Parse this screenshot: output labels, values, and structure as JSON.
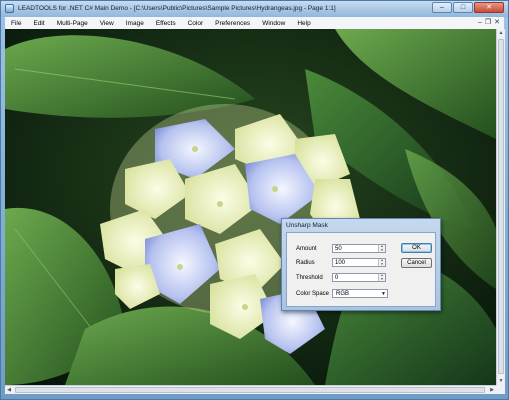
{
  "window": {
    "title": "LEADTOOLS for .NET C# Main Demo - [C:\\Users\\Public\\Pictures\\Sample Pictures\\Hydrangeas.jpg - Page 1:1]",
    "minimize": "–",
    "maximize": "□",
    "close": "✕"
  },
  "menubar": {
    "items": [
      "File",
      "Edit",
      "Multi-Page",
      "View",
      "Image",
      "Effects",
      "Color",
      "Preferences",
      "Window",
      "Help"
    ],
    "doc_min": "–",
    "doc_restore": "❐",
    "doc_close": "✕"
  },
  "image": {
    "subject": "hydrangea-photo"
  },
  "dialog": {
    "title": "Unsharp Mask",
    "amount_label": "Amount",
    "amount_value": "50",
    "radius_label": "Radius",
    "radius_value": "100",
    "threshold_label": "Threshold",
    "threshold_value": "0",
    "colorspace_label": "Color Space",
    "colorspace_value": "RGB",
    "ok_label": "OK",
    "cancel_label": "Cancel"
  },
  "colors": {
    "title_bar": "#a8c6e4",
    "close_button": "#c94a33",
    "menu_background": "#f3f5f9",
    "dialog_body": "#f0f0f0"
  }
}
